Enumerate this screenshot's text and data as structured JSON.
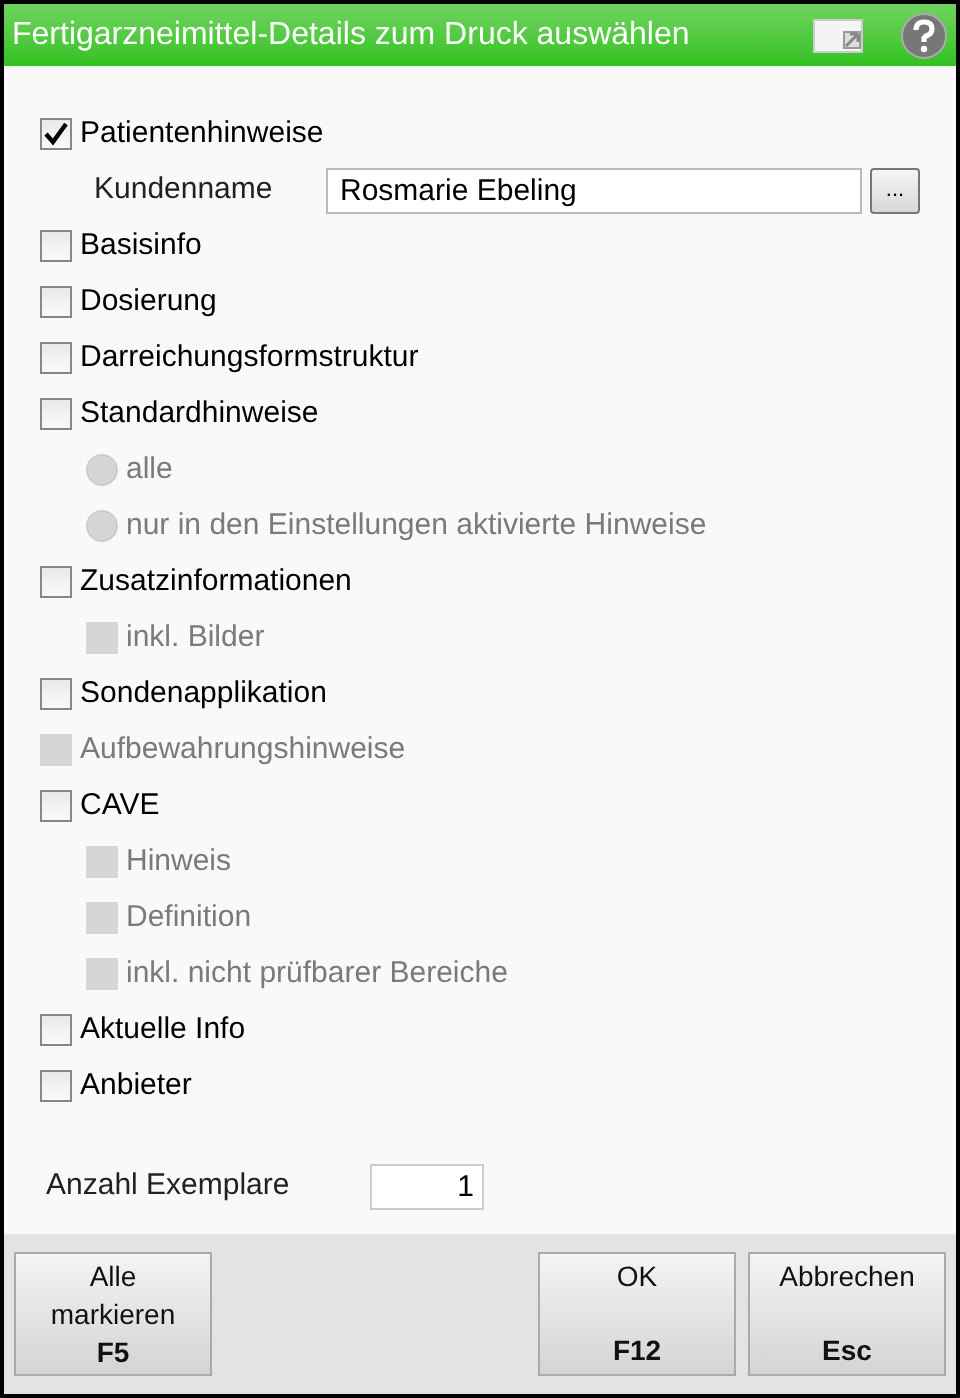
{
  "window": {
    "title": "Fertigarzneimittel-Details zum Druck auswählen"
  },
  "options": [
    {
      "kind": "checkbox",
      "label": "Patientenhinweise",
      "checked": true,
      "disabled": false,
      "children": [
        {
          "kind": "field",
          "label": "Kundenname",
          "value": "Rosmarie Ebeling",
          "button": "..."
        }
      ]
    },
    {
      "kind": "checkbox",
      "label": "Basisinfo",
      "checked": false,
      "disabled": false
    },
    {
      "kind": "checkbox",
      "label": "Dosierung",
      "checked": false,
      "disabled": false
    },
    {
      "kind": "checkbox",
      "label": "Darreichungsformstruktur",
      "checked": false,
      "disabled": false
    },
    {
      "kind": "checkbox",
      "label": "Standardhinweise",
      "checked": false,
      "disabled": false,
      "children": [
        {
          "kind": "radio",
          "label": "alle",
          "selected": false,
          "disabled": true
        },
        {
          "kind": "radio",
          "label": "nur in den Einstellungen aktivierte Hinweise",
          "selected": false,
          "disabled": true
        }
      ]
    },
    {
      "kind": "checkbox",
      "label": "Zusatzinformationen",
      "checked": false,
      "disabled": false,
      "children": [
        {
          "kind": "checkbox",
          "label": "inkl. Bilder",
          "checked": false,
          "disabled": true
        }
      ]
    },
    {
      "kind": "checkbox",
      "label": "Sondenapplikation",
      "checked": false,
      "disabled": false
    },
    {
      "kind": "checkbox",
      "label": "Aufbewahrungshinweise",
      "checked": false,
      "disabled": true
    },
    {
      "kind": "checkbox",
      "label": "CAVE",
      "checked": false,
      "disabled": false,
      "children": [
        {
          "kind": "checkbox",
          "label": "Hinweis",
          "checked": false,
          "disabled": true
        },
        {
          "kind": "checkbox",
          "label": "Definition",
          "checked": false,
          "disabled": true
        },
        {
          "kind": "checkbox",
          "label": "inkl. nicht prüfbarer Bereiche",
          "checked": false,
          "disabled": true
        }
      ]
    },
    {
      "kind": "checkbox",
      "label": "Aktuelle Info",
      "checked": false,
      "disabled": false
    },
    {
      "kind": "checkbox",
      "label": "Anbieter",
      "checked": false,
      "disabled": false
    }
  ],
  "copies": {
    "label": "Anzahl Exemplare",
    "value": "1"
  },
  "buttons": [
    {
      "label": "Alle markieren",
      "key": "F5"
    },
    {
      "label": "OK",
      "key": "F12"
    },
    {
      "label": "Abbrechen",
      "key": "Esc"
    }
  ]
}
